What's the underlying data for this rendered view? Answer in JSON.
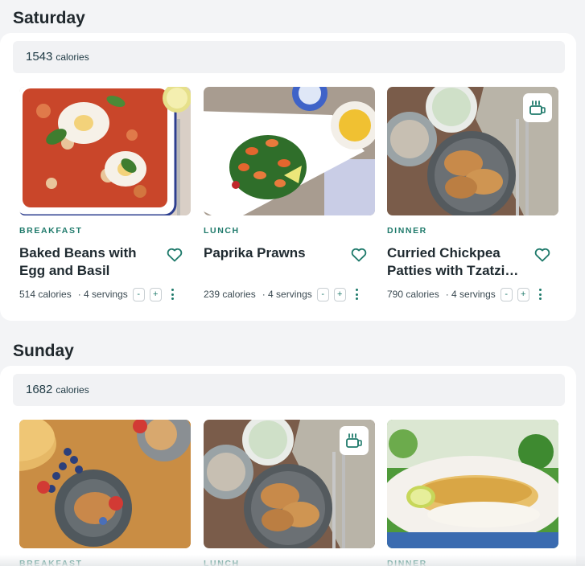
{
  "days": [
    {
      "name": "Saturday",
      "calories_value": "1543",
      "calories_unit": "calories",
      "meals": [
        {
          "type": "BREAKFAST",
          "title": "Baked Beans with Egg and Basil",
          "calories": "514 calories",
          "servings": "· 4 servings",
          "minus": "-",
          "plus": "+"
        },
        {
          "type": "LUNCH",
          "title": "Paprika Prawns",
          "calories": "239 calories",
          "servings": "· 4 servings",
          "minus": "-",
          "plus": "+"
        },
        {
          "type": "DINNER",
          "title": "Curried Chickpea Patties with Tzatzi…",
          "calories": "790 calories",
          "servings": "· 4 servings",
          "minus": "-",
          "plus": "+",
          "leftover_icon": "leftovers-container-icon"
        }
      ]
    },
    {
      "name": "Sunday",
      "calories_value": "1682",
      "calories_unit": "calories",
      "meals": [
        {
          "type": "BREAKFAST"
        },
        {
          "type": "LUNCH",
          "leftover_icon": "leftovers-container-icon"
        },
        {
          "type": "DINNER"
        }
      ]
    }
  ],
  "colors": {
    "accent": "#1f7a6b",
    "panel": "#ffffff",
    "background": "#f3f4f6"
  }
}
